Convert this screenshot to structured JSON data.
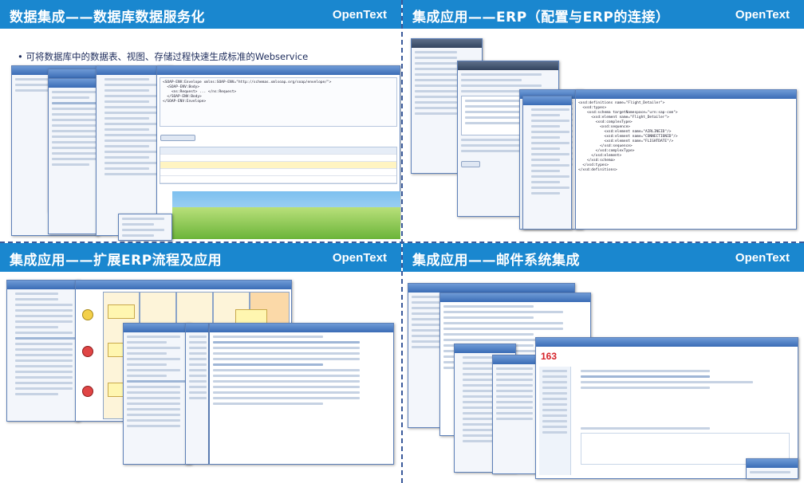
{
  "brand": "OpenText",
  "quadrants": [
    {
      "title": "数据集成——数据库数据服务化",
      "bullet": "• 可将数据库中的数据表、视图、存储过程快速生成标准的Webservice"
    },
    {
      "title": "集成应用——ERP（配置与ERP的连接）"
    },
    {
      "title": "集成应用——扩展ERP流程及应用"
    },
    {
      "title": "集成应用——邮件系统集成"
    }
  ],
  "mail_logo": "163"
}
